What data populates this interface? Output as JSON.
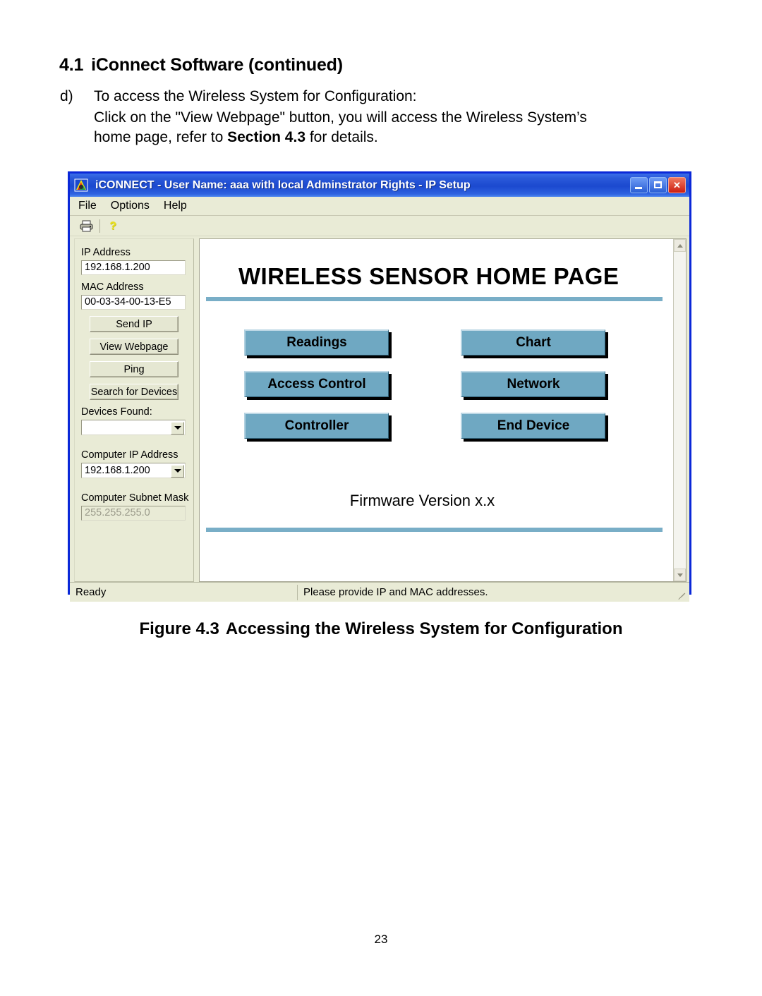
{
  "document": {
    "heading_number": "4.1",
    "heading_text": "iConnect Software (continued)",
    "item_letter": "d)",
    "item_line1": "To access the Wireless System for Configuration:",
    "item_line2": "Click on the \"View Webpage\" button, you will access the Wireless System’s",
    "item_line3_pre": "home page, refer to ",
    "item_line3_bold": "Section 4.3",
    "item_line3_post": " for details.",
    "figure_caption_label": "Figure 4.3",
    "figure_caption_text": "Accessing the Wireless System for Configuration",
    "page_number": "23"
  },
  "window": {
    "title": "iCONNECT - User Name: aaa with local Adminstrator Rights - IP Setup",
    "app_icon": "application-icon",
    "controls": {
      "minimize": "minimize-icon",
      "maximize": "maximize-icon",
      "close": "✕"
    },
    "menu": [
      "File",
      "Options",
      "Help"
    ],
    "toolbar": [
      {
        "icon": "print-icon",
        "name": "print-button"
      },
      {
        "icon": "help-icon",
        "name": "help-button"
      }
    ],
    "status": {
      "left": "Ready",
      "right": "Please provide IP and MAC addresses."
    }
  },
  "sidebar": {
    "ip_address": {
      "label": "IP Address",
      "value": "192.168.1.200"
    },
    "mac_address": {
      "label": "MAC Address",
      "value": "00-03-34-00-13-E5"
    },
    "buttons": [
      {
        "label": "Send IP",
        "name": "send-ip-button"
      },
      {
        "label": "View Webpage",
        "name": "view-webpage-button"
      },
      {
        "label": "Ping",
        "name": "ping-button"
      },
      {
        "label": "Search for Devices",
        "name": "search-for-devices-button"
      }
    ],
    "devices_found": {
      "label": "Devices Found:",
      "value": ""
    },
    "computer_ip": {
      "label": "Computer IP Address",
      "value": "192.168.1.200"
    },
    "computer_subnet": {
      "label": "Computer Subnet Mask",
      "value": "255.255.255.0"
    }
  },
  "webpage": {
    "title": "WIRELESS SENSOR HOME PAGE",
    "buttons": [
      {
        "label": "Readings",
        "name": "readings-button"
      },
      {
        "label": "Chart",
        "name": "chart-button"
      },
      {
        "label": "Access Control",
        "name": "access-control-button"
      },
      {
        "label": "Network",
        "name": "network-button"
      },
      {
        "label": "Controller",
        "name": "controller-button"
      },
      {
        "label": "End Device",
        "name": "end-device-button"
      }
    ],
    "firmware": "Firmware Version x.x",
    "accent_color": "#79aec7",
    "button_color": "#6fa8c2"
  }
}
